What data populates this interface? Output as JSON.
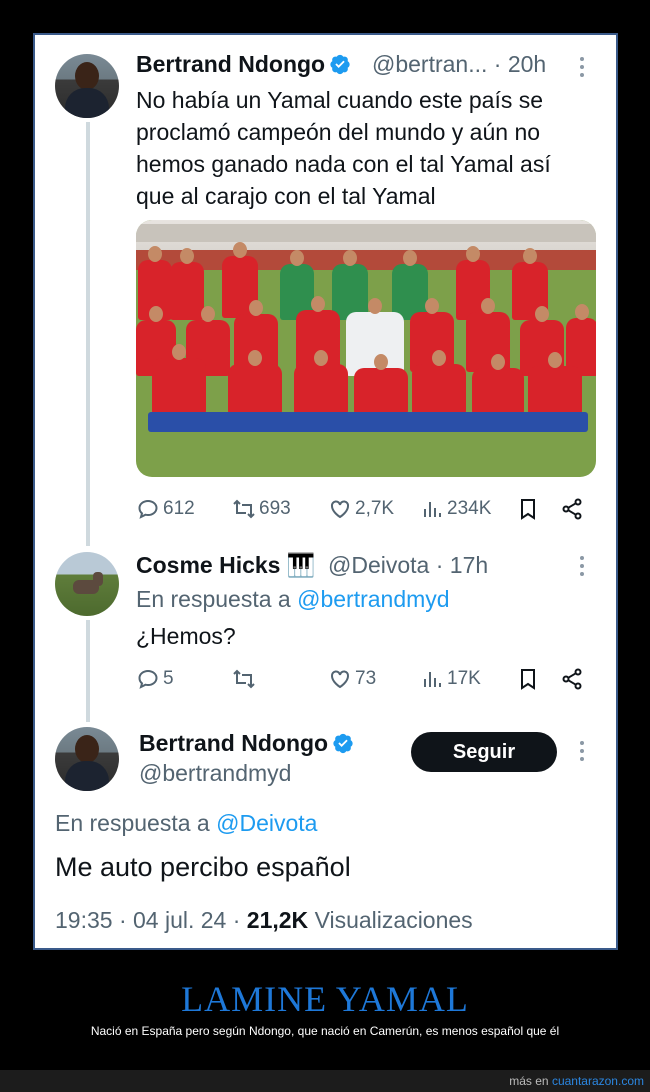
{
  "tweet1": {
    "name": "Bertrand Ndongo",
    "handle": "@bertran...",
    "time": "· 20h",
    "text": "No había un Yamal cuando este país se proclamó campeón del mundo y aún no hemos ganado nada con el tal Yamal así que al carajo con el tal Yamal",
    "stats": {
      "replies": "612",
      "retweets": "693",
      "likes": "2,7K",
      "views": "234K"
    }
  },
  "tweet2": {
    "name": "Cosme Hicks",
    "name_emoji": "🎹",
    "handle": "@Deivota",
    "time": "· 17h",
    "reply_prefix": "En respuesta a",
    "reply_mention": "@bertrandmyd",
    "text": "¿Hemos?",
    "stats": {
      "replies": "5",
      "retweets": "",
      "likes": "73",
      "views": "17K"
    }
  },
  "tweet3": {
    "name": "Bertrand Ndongo",
    "handle": "@bertrandmyd",
    "follow_label": "Seguir",
    "reply_prefix": "En respuesta a",
    "reply_mention": "@Deivota",
    "text": "Me auto percibo español",
    "timestamp": "19:35 · 04 jul. 24 ·",
    "views_count": "21,2K",
    "views_label": "Visualizaciones"
  },
  "caption": {
    "title": "LAMINE YAMAL",
    "subtitle": "Nació en España pero según Ndongo, que nació en Camerún, es menos español que él"
  },
  "footer": {
    "prefix": "más en",
    "site": "cuantarazon.com"
  },
  "colors": {
    "link": "#1d9bf0",
    "verified": "#1d9bf0",
    "caption_title": "#1e78d8",
    "follow_button": "#0f1419"
  },
  "icons": [
    "verified-icon",
    "more-icon",
    "reply-icon",
    "retweet-icon",
    "like-icon",
    "views-icon",
    "bookmark-icon",
    "share-icon"
  ]
}
